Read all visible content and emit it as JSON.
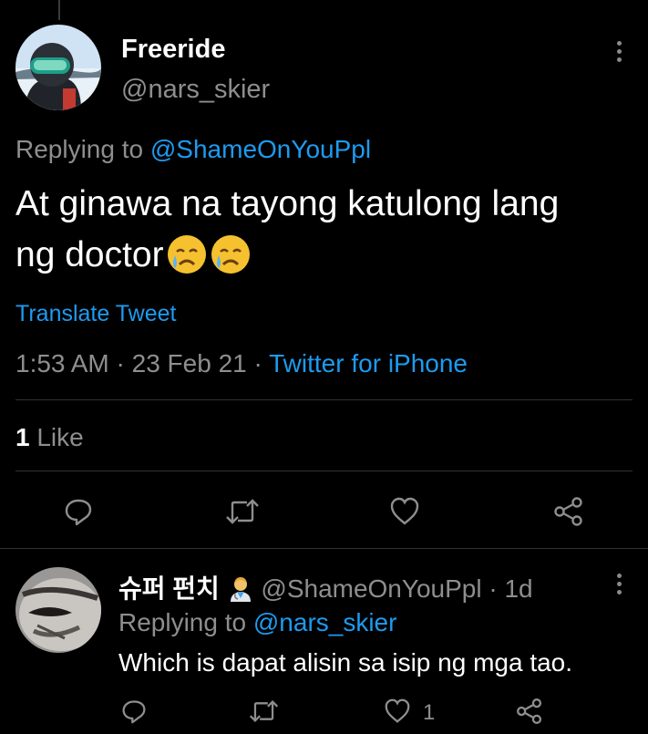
{
  "main_tweet": {
    "display_name": "Freeride",
    "handle": "@nars_skier",
    "replying_prefix": "Replying to",
    "replying_handle": "@ShameOnYouPpl",
    "text_line1": "At ginawa na tayong katulong lang",
    "text_line2": "ng doctor",
    "emojis": [
      "crying-face-icon",
      "crying-face-icon"
    ],
    "translate_label": "Translate Tweet",
    "time": "1:53 AM",
    "sep1": "·",
    "date": "23 Feb 21",
    "sep2": "·",
    "source": "Twitter for iPhone",
    "like_count": "1",
    "like_label": "Like"
  },
  "reply": {
    "display_name": "슈퍼 펀치",
    "handle_and_time": "@ShameOnYouPpl · 1d",
    "replying_prefix": "Replying to",
    "replying_handle": "@nars_skier",
    "text": "Which is dapat alisin sa isip ng mga tao.",
    "like_count": "1"
  },
  "colors": {
    "background": "#000000",
    "link": "#1d9bf0",
    "secondary": "#8e8e8e",
    "divider": "#2f3336"
  }
}
